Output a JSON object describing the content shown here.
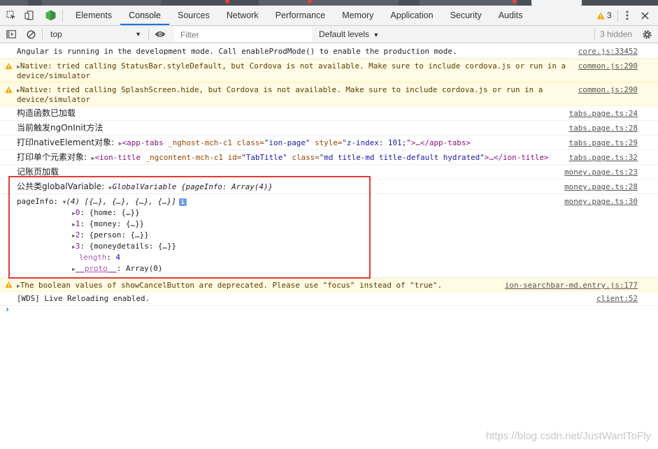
{
  "devtools": {
    "tabs": [
      "Elements",
      "Console",
      "Sources",
      "Network",
      "Performance",
      "Memory",
      "Application",
      "Security",
      "Audits"
    ],
    "active_tab": "Console",
    "warning_count": "3",
    "icons": [
      "inspect-icon",
      "device-toolbar-icon",
      "angular-extension-icon",
      "warning-icon",
      "more-icon",
      "close-icon"
    ]
  },
  "console_bar": {
    "context": "top",
    "filter_placeholder": "Filter",
    "levels": "Default levels",
    "hidden": "3 hidden"
  },
  "logs": {
    "l0": {
      "text": "Angular is running in the development mode. Call enableProdMode() to enable the production mode.",
      "src": "core.js:33452"
    },
    "l1": {
      "text1": "Native: tried calling StatusBar.styleDefault, but Cordova is not available. Make sure to include cordova.js or run in a",
      "text2": "device/simulator",
      "src": "common.js:290"
    },
    "l2": {
      "text1": "Native: tried calling SplashScreen.hide, but Cordova is not available. Make sure to include cordova.js or run in a",
      "text2": "device/simulator",
      "src": "common.js:290"
    },
    "l3": {
      "text": "构造函数已加载",
      "src": "tabs.page.ts:24"
    },
    "l4": {
      "text": "当前触发ngOnInit方法",
      "src": "tabs.page.ts:28"
    },
    "l5": {
      "label": "打印nativeElement对象:",
      "tag_open": "<app-tabs",
      "attrs": " _nghost-mch-c1 class=",
      "class_val": "\"ion-page\"",
      "style_attr": " style=",
      "style_val": "\"z-index: 101;\"",
      "tag_rest": ">…</app-tabs>",
      "src": "tabs.page.ts:29"
    },
    "l6": {
      "label": "打印单个元素对象:",
      "tag_open": "<ion-title",
      "attrs": " _ngcontent-mch-c1 id=",
      "id_val": "\"TabTitle\"",
      "class_attr": " class=",
      "class_val": "\"md title-md title-default hydrated\"",
      "tag_rest": ">…</ion-title>",
      "src": "tabs.page.ts:32"
    },
    "l7": {
      "text": "记账页加载",
      "src": "money.page.ts:23"
    },
    "l8": {
      "label": "公共类globalVariable:",
      "obj": "GlobalVariable {pageInfo: Array(4)}",
      "src": "money.page.ts:28"
    },
    "l9": {
      "label": "pageInfo:",
      "summary": "(4) [{…}, {…}, {…}, {…}]",
      "items": [
        {
          "key": "0",
          "val": "{home: {…}}"
        },
        {
          "key": "1",
          "val": "{money: {…}}"
        },
        {
          "key": "2",
          "val": "{person: {…}}"
        },
        {
          "key": "3",
          "val": "{moneydetails: {…}}"
        }
      ],
      "length_key": "length",
      "length_val": "4",
      "proto_key": "__proto__",
      "proto_val": ": Array(0)",
      "src": "money.page.ts:30"
    },
    "l10": {
      "text": "The boolean values of showCancelButton are deprecated. Please use \"focus\" instead of \"true\".",
      "src": "ion-searchbar-md.entry.js:177"
    },
    "l11": {
      "text": "[WDS] Live Reloading enabled.",
      "src": "client:52"
    }
  },
  "watermark": "https://blog.csdn.net/JustWantToFly",
  "colors": {
    "warn_bg": "#fffbe5",
    "warn_text": "#5c3b00",
    "highlight": "#e53935",
    "accent": "#1a73e8"
  }
}
